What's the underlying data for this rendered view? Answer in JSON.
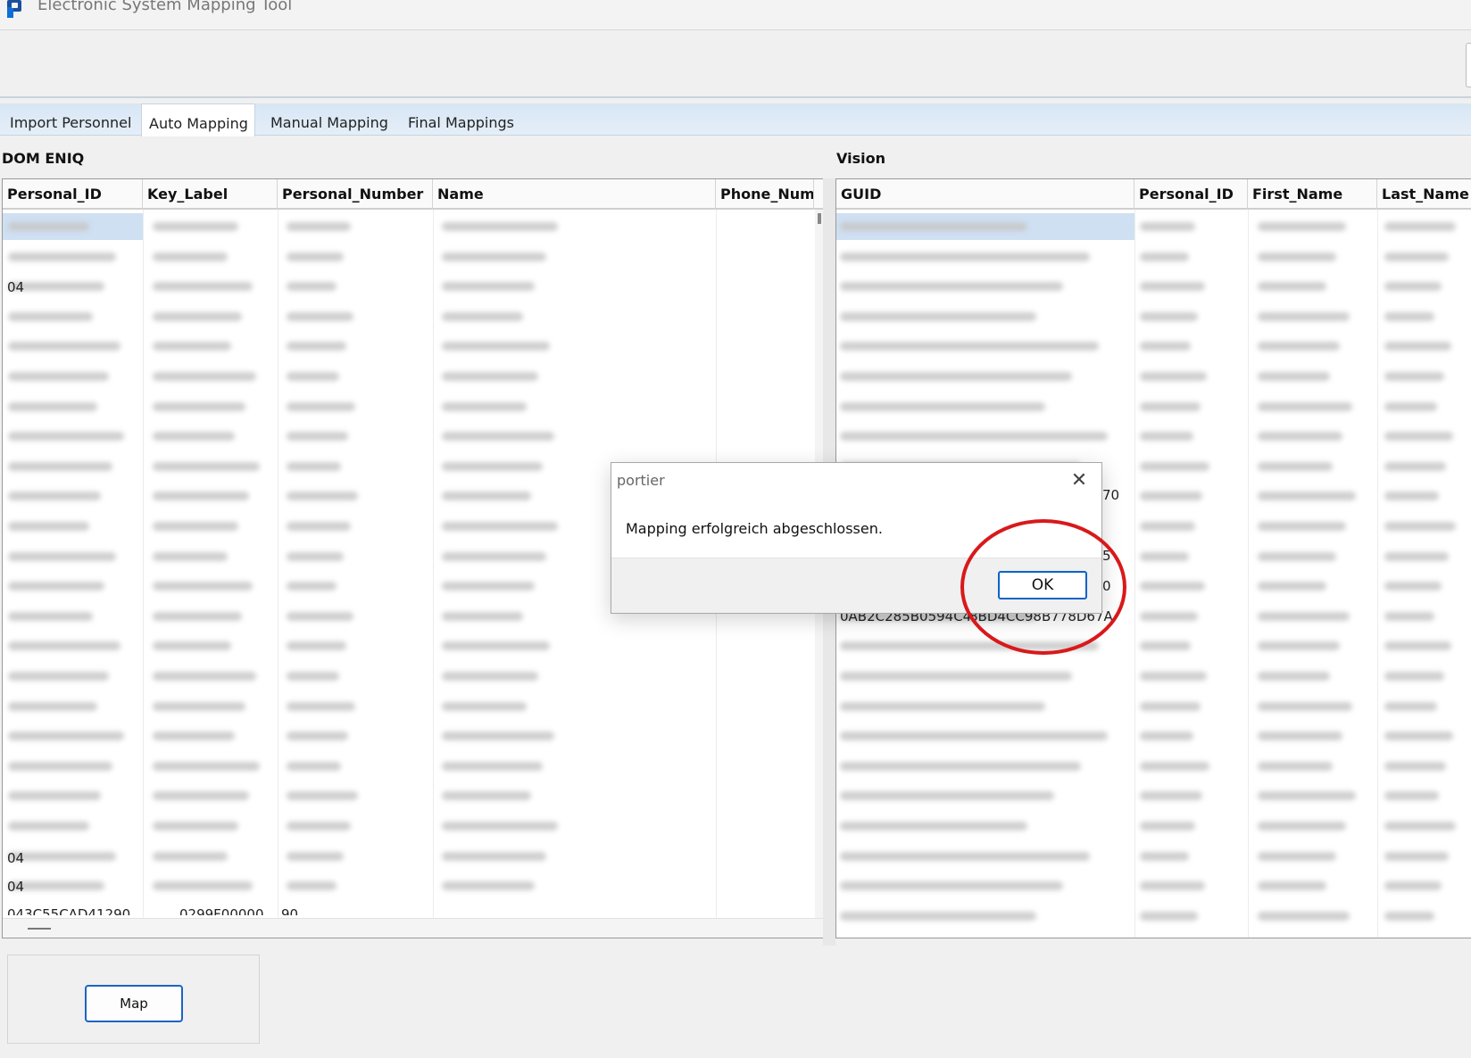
{
  "window": {
    "title": "Electronic System Mapping Tool",
    "logo_icon": "app-logo-icon"
  },
  "tabs": [
    {
      "label": "Import Personnel",
      "active": false
    },
    {
      "label": "Auto Mapping",
      "active": true
    },
    {
      "label": "Manual Mapping",
      "active": false
    },
    {
      "label": "Final Mappings",
      "active": false
    }
  ],
  "left_panel": {
    "label": "DOM ENIQ",
    "columns": [
      "Personal_ID",
      "Key_Label",
      "Personal_Number",
      "Name",
      "Phone_Num"
    ],
    "row_count": 23,
    "partial_texts": [
      "04",
      "04",
      "04",
      "043C55CAD41290",
      "0299F00000",
      "90"
    ]
  },
  "right_panel": {
    "label": "Vision",
    "columns": [
      "GUID",
      "Personal_ID",
      "First_Name",
      "Last_Name"
    ],
    "row_count": 24,
    "partial_texts": [
      "70",
      "5",
      "0",
      "0AB2C285B0594C4",
      "8BD4CC98B778D67A"
    ]
  },
  "actions": {
    "map_label": "Map"
  },
  "dialog": {
    "title": "portier",
    "message": "Mapping erfolgreich abgeschlossen.",
    "ok_label": "OK",
    "close_glyph": "✕"
  },
  "colors": {
    "tab_bar": "#d8e6f4",
    "selection": "#cfe0f3",
    "button_border": "#1c64c4",
    "annotation": "#d8191b"
  }
}
